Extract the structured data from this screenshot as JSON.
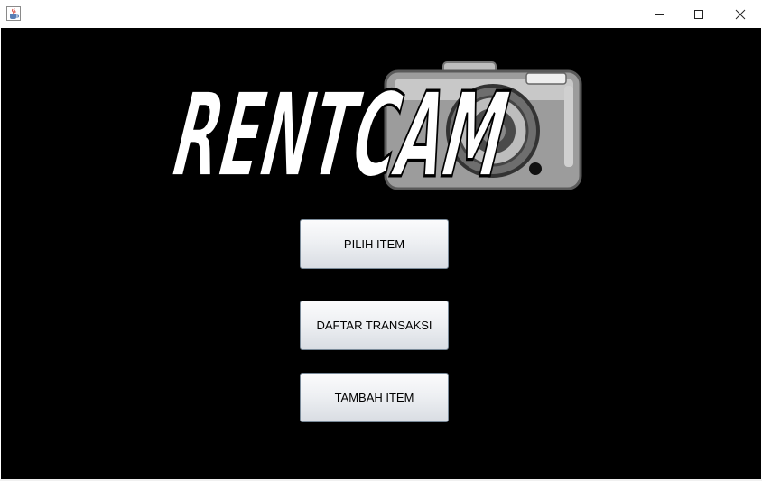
{
  "window": {
    "icons": {
      "app": "java-cup-icon",
      "minimize": "minimize-icon",
      "maximize": "maximize-icon",
      "close": "close-icon"
    }
  },
  "logo": {
    "text": "RENTCAM",
    "icon": "camera-icon"
  },
  "menu": {
    "buttons": [
      {
        "label": "PILIH ITEM"
      },
      {
        "label": "DAFTAR TRANSAKSI"
      },
      {
        "label": "TAMBAH ITEM"
      }
    ]
  },
  "colors": {
    "background": "#000000",
    "button_border": "#7a8a99",
    "titlebar": "#ffffff"
  }
}
